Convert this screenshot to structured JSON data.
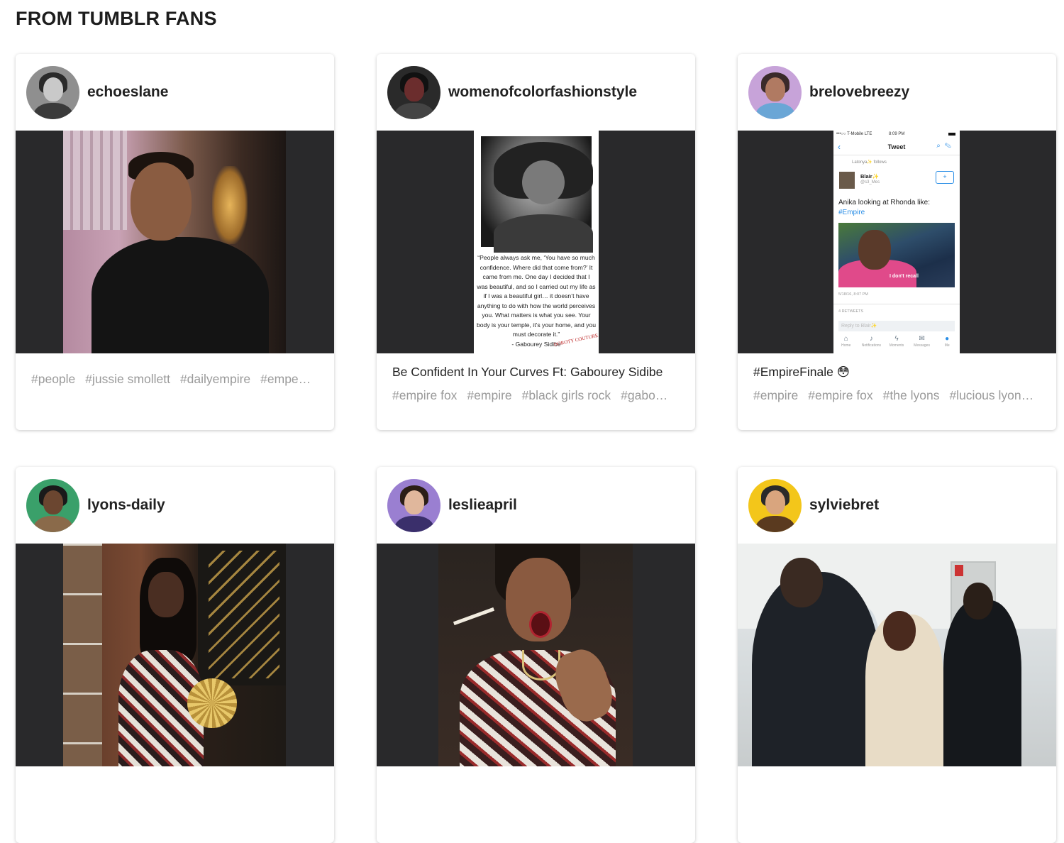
{
  "section": {
    "title": "FROM TUMBLR FANS"
  },
  "cards": [
    {
      "username": "echoeslane",
      "avatar": {
        "bg": "#8f8f8f",
        "hair": "#2a2a2a",
        "face": "#c9c9c9",
        "body": "#3a3a3a"
      },
      "caption": "",
      "tags": [
        "#people",
        "#jussie smollett",
        "#dailyempire",
        "#empe…"
      ]
    },
    {
      "username": "womenofcolorfashionstyle",
      "avatar": {
        "bg": "#2a2a2a",
        "hair": "#111111",
        "face": "#6b2d2d",
        "body": "#444444"
      },
      "caption": "Be Confident In Your Curves Ft: Gabourey Sidibe",
      "tags": [
        "#empire fox",
        "#empire",
        "#black girls rock",
        "#gabo…"
      ],
      "image_quote": "“People always ask me, ‘You have so much confidence. Where did that come from?’ It came from me. One day I decided that I was beautiful, and so I carried out my life as if I was a beautiful girl… it doesn’t have anything to do with how the world perceives you. What matters is what you see. Your body is your temple, it’s your home, and you must decorate it.”",
      "image_quote_author": "- Gabourey Sidibe",
      "image_stamp": "DOROTY COUTURE XO"
    },
    {
      "username": "brelovebreezy",
      "avatar": {
        "bg": "#c7a3d9",
        "hair": "#3a2a2a",
        "face": "#b07a62",
        "body": "#6aa6d6"
      },
      "caption": "#EmpireFinale 😳",
      "tags": [
        "#empire",
        "#empire fox",
        "#the lyons",
        "#lucious lyon…"
      ],
      "tweet": {
        "carrier": "•••○○ T-Mobile  LTE",
        "time": "8:09 PM",
        "nav_title": "Tweet",
        "follows": "Latonya✨ follows",
        "name": "Blair✨",
        "handle": "@s3_Mes",
        "text": "Anika looking at Rhonda like:",
        "hashtag": "#Empire",
        "image_caption": "I don't recall",
        "date": "5/18/16, 8:07 PM",
        "retweets": "4 RETWEETS",
        "reply_placeholder": "Reply to Blair✨",
        "tabs": [
          "Home",
          "Notifications",
          "Moments",
          "Messages",
          "Me"
        ]
      }
    },
    {
      "username": "lyons-daily",
      "avatar": {
        "bg": "#3aa06a",
        "hair": "#1a1a1a",
        "face": "#6b4630",
        "body": "#8a6a4a"
      },
      "caption": "",
      "tags": []
    },
    {
      "username": "leslieapril",
      "avatar": {
        "bg": "#9a7fd1",
        "hair": "#2b1e16",
        "face": "#e0b79c",
        "body": "#3a2f6b"
      },
      "caption": "",
      "tags": []
    },
    {
      "username": "sylviebret",
      "avatar": {
        "bg": "#f3c61a",
        "hair": "#2a2a2a",
        "face": "#d9a57e",
        "body": "#5a3a1f"
      },
      "caption": "",
      "tags": []
    }
  ]
}
